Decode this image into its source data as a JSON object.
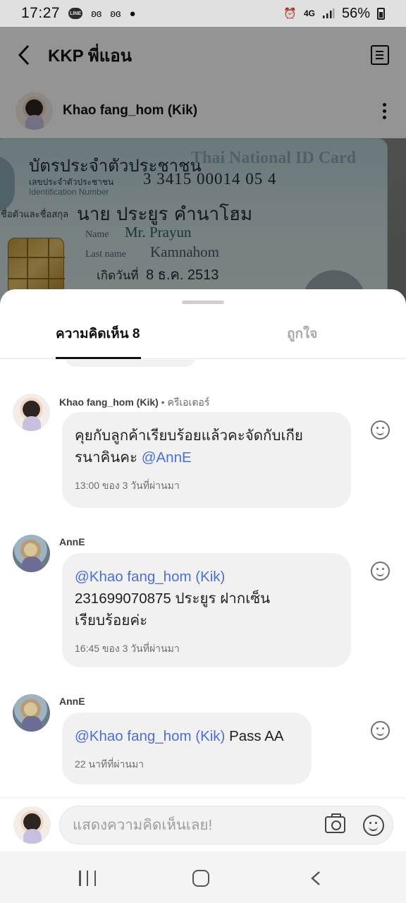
{
  "status_bar": {
    "time": "17:27",
    "network": "4G",
    "battery": "56%",
    "icons": [
      "line-icon",
      "butterfly-icon",
      "butterfly-icon",
      "dot-icon",
      "alarm-icon",
      "signal-icon",
      "battery-icon"
    ]
  },
  "header": {
    "title": "KKP พี่แอน",
    "back_icon": "back-arrow-icon",
    "menu_icon": "list-icon"
  },
  "post_author": {
    "name": "Khao fang_hom (Kik)",
    "more_icon": "more-vertical-icon"
  },
  "id_card": {
    "title_th": "บัตรประจำตัวประชาชน",
    "title_en": "Thai National ID Card",
    "id_label_th": "เลขประจำตัวประชาชน",
    "id_label_en": "Identification Number",
    "id_number": "3 3415 00014 05 4",
    "name_label_th": "ชื่อตัวและชื่อสกุล",
    "name_th": "นาย ประยูร คำนาโฮม",
    "name_label_en": "Name",
    "name_en": "Mr. Prayun",
    "lastname_label_en": "Last name",
    "lastname_en": "Kamnahom",
    "birth_label_th": "เกิดวันที่",
    "birth_th": "8 ธ.ค. 2513"
  },
  "sheet": {
    "tabs": [
      {
        "label": "ความคิดเห็น 8",
        "active": true
      },
      {
        "label": "ถูกใจ",
        "active": false
      }
    ],
    "comments": [
      {
        "author": "Khao fang_hom (Kik)",
        "role": "• ครีเอเตอร์",
        "mention": "@AnnE",
        "text": "คุยกับลูกค้าเรียบร้อยแล้วคะจัดกับเกียรนาคินคะ",
        "text_line1": "คุยกับลูกค้าเรียบร้อยแล้วคะจัดกับเกีย",
        "text_line2": "รนาคินคะ",
        "time": "13:00 ของ 3 วันที่ผ่านมา"
      },
      {
        "author": "AnnE",
        "mention": "@Khao fang_hom (Kik)",
        "text": "231699070875 ประยูร ฝากเซ็นเรียบร้อยค่ะ",
        "text_line1": "231699070875 ประยูร ฝากเซ็น",
        "text_line2": "เรียบร้อยค่ะ",
        "time": "16:45 ของ 3 วันที่ผ่านมา"
      },
      {
        "author": "AnnE",
        "mention": "@Khao fang_hom (Kik)",
        "text": "Pass AA",
        "time": "22 นาทีที่ผ่านมา"
      }
    ],
    "input": {
      "placeholder": "แสดงความคิดเห็นเลย!",
      "camera_icon": "camera-icon",
      "emoji_icon": "emoji-icon"
    }
  },
  "nav_bar": {
    "icons": [
      "recents-icon",
      "home-icon",
      "back-icon"
    ]
  },
  "colors": {
    "mention": "#4a6fd8",
    "bubble": "#f1f1f1",
    "overlay": "rgba(0,0,0,0.42)",
    "tab_inactive": "#a9a9a9"
  }
}
